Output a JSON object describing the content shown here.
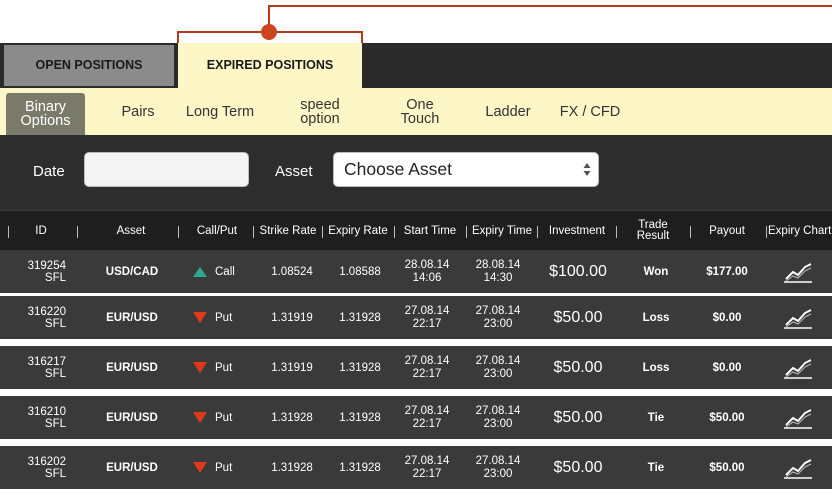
{
  "colors": {
    "accent": "#c8461c",
    "tab_active_bg": "#fdf7c7",
    "tab_inactive_bg": "#8b8b8b",
    "panel_dark": "#2d2d2d",
    "row_bg": "#3a3a3a",
    "call_color": "#2eab8e",
    "put_color": "#e03a1a"
  },
  "main_tabs": [
    {
      "label": "OPEN POSITIONS"
    },
    {
      "label": "EXPIRED POSITIONS"
    }
  ],
  "sub_tabs": [
    {
      "label": "Binary Options"
    },
    {
      "label": "Pairs"
    },
    {
      "label": "Long Term"
    },
    {
      "label": "speed option"
    },
    {
      "label": "One Touch"
    },
    {
      "label": "Ladder"
    },
    {
      "label": "FX / CFD"
    }
  ],
  "filters": {
    "date_label": "Date",
    "date_value": "",
    "asset_label": "Asset",
    "asset_selected": "Choose Asset"
  },
  "columns": [
    "ID",
    "Asset",
    "Call/Put",
    "Strike Rate",
    "Expiry Rate",
    "Start Time",
    "Expiry Time",
    "Investment",
    "Trade Result",
    "Payout",
    "Expiry Chart"
  ],
  "rows": [
    {
      "id": "319254",
      "id_suffix": "SFL",
      "asset": "USD/CAD",
      "direction": "Call",
      "icon": "call-up-arrow",
      "strike": "1.08524",
      "expiry_rate": "1.08588",
      "start_date": "28.08.14",
      "start_time": "14:06",
      "expiry_date": "28.08.14",
      "expiry_time": "14:30",
      "investment": "$100.00",
      "result": "Won",
      "payout": "$177.00"
    },
    {
      "id": "316220",
      "id_suffix": "SFL",
      "asset": "EUR/USD",
      "direction": "Put",
      "icon": "put-down-arrow",
      "strike": "1.31919",
      "expiry_rate": "1.31928",
      "start_date": "27.08.14",
      "start_time": "22:17",
      "expiry_date": "27.08.14",
      "expiry_time": "23:00",
      "investment": "$50.00",
      "result": "Loss",
      "payout": "$0.00"
    },
    {
      "id": "316217",
      "id_suffix": "SFL",
      "asset": "EUR/USD",
      "direction": "Put",
      "icon": "put-down-arrow",
      "strike": "1.31919",
      "expiry_rate": "1.31928",
      "start_date": "27.08.14",
      "start_time": "22:17",
      "expiry_date": "27.08.14",
      "expiry_time": "23:00",
      "investment": "$50.00",
      "result": "Loss",
      "payout": "$0.00"
    },
    {
      "id": "316210",
      "id_suffix": "SFL",
      "asset": "EUR/USD",
      "direction": "Put",
      "icon": "put-down-arrow",
      "strike": "1.31928",
      "expiry_rate": "1.31928",
      "start_date": "27.08.14",
      "start_time": "22:17",
      "expiry_date": "27.08.14",
      "expiry_time": "23:00",
      "investment": "$50.00",
      "result": "Tie",
      "payout": "$50.00"
    },
    {
      "id": "316202",
      "id_suffix": "SFL",
      "asset": "EUR/USD",
      "direction": "Put",
      "icon": "put-down-arrow",
      "strike": "1.31928",
      "expiry_rate": "1.31928",
      "start_date": "27.08.14",
      "start_time": "22:17",
      "expiry_date": "27.08.14",
      "expiry_time": "23:00",
      "investment": "$50.00",
      "result": "Tie",
      "payout": "$50.00"
    }
  ]
}
